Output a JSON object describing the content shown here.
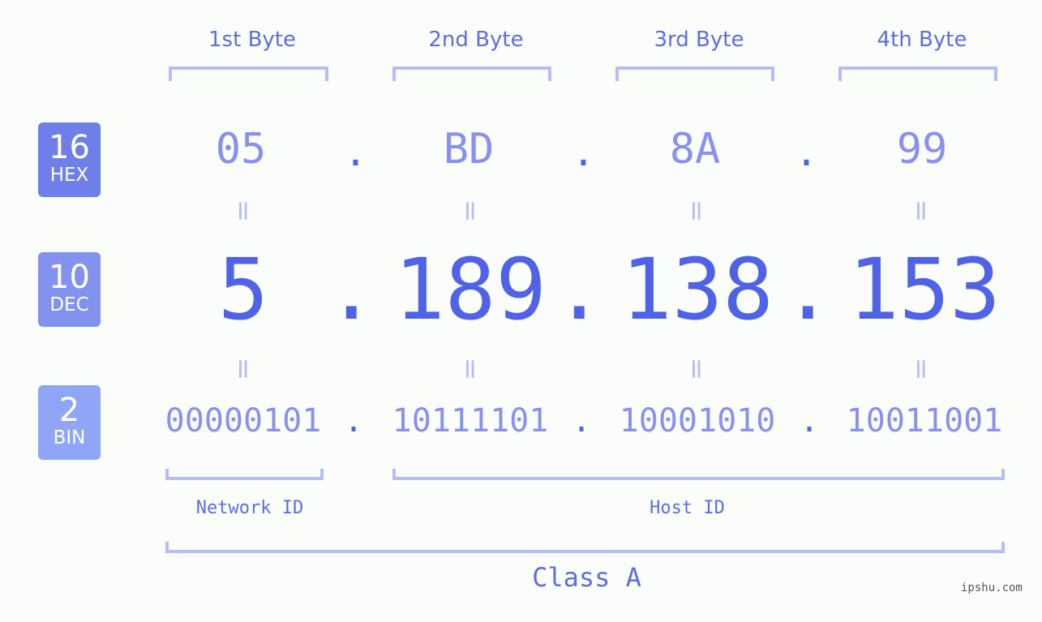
{
  "bytes": {
    "headers": [
      "1st Byte",
      "2nd Byte",
      "3rd Byte",
      "4th Byte"
    ]
  },
  "badges": {
    "hex": {
      "number": "16",
      "label": "HEX",
      "color": "#6f7fe9"
    },
    "dec": {
      "number": "10",
      "label": "DEC",
      "color": "#8391ef"
    },
    "bin": {
      "number": "2",
      "label": "BIN",
      "color": "#8fa6f6"
    }
  },
  "ip": {
    "hex": [
      "05",
      "BD",
      "8A",
      "99"
    ],
    "dec": [
      "5",
      "189",
      "138",
      "153"
    ],
    "bin": [
      "00000101",
      "10111101",
      "10001010",
      "10011001"
    ],
    "separator": ".",
    "equals": "="
  },
  "segments": {
    "network_label": "Network ID",
    "host_label": "Host ID",
    "class_label": "Class A"
  },
  "watermark": "ipshu.com",
  "colors": {
    "accent": "#4f63e6",
    "light_accent": "#8791ee",
    "bracket": "#b3bdf7",
    "background": "#fbfdfb"
  }
}
